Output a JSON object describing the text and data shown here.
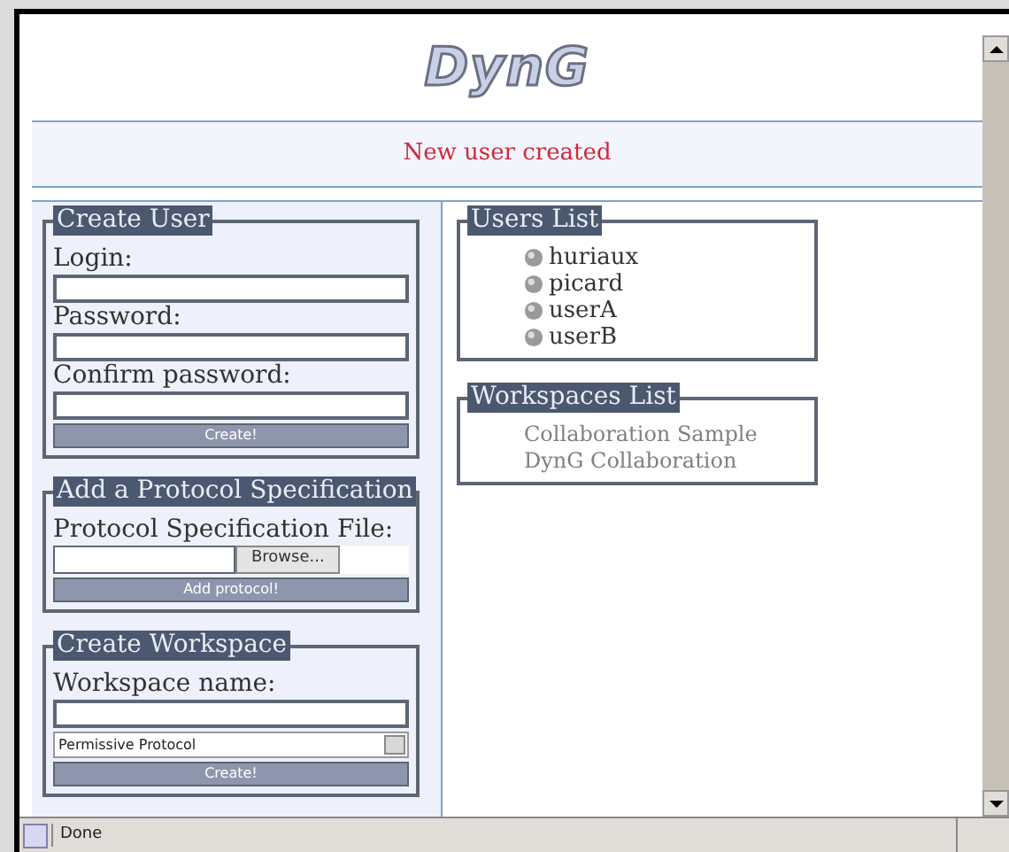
{
  "logo": "DynG",
  "message": "New user created",
  "create_user": {
    "title": "Create User",
    "fields": [
      {
        "label": "Login:"
      },
      {
        "label": "Password:"
      },
      {
        "label": "Confirm password:"
      }
    ],
    "button": "Create!"
  },
  "protocol": {
    "title": "Add a Protocol Specification",
    "label": "Protocol Specification File:",
    "browse": "Browse...",
    "button": "Add protocol!"
  },
  "workspace": {
    "title": "Create Workspace",
    "label": "Workspace name:",
    "select": "Permissive Protocol",
    "button": "Create!"
  },
  "users_list": {
    "title": "Users List",
    "users": [
      "huriaux",
      "picard",
      "userA",
      "userB"
    ]
  },
  "workspaces_list": {
    "title": "Workspaces List",
    "items": [
      "Collaboration Sample",
      "DynG Collaboration"
    ]
  },
  "status_bar": {
    "text": "Done"
  }
}
